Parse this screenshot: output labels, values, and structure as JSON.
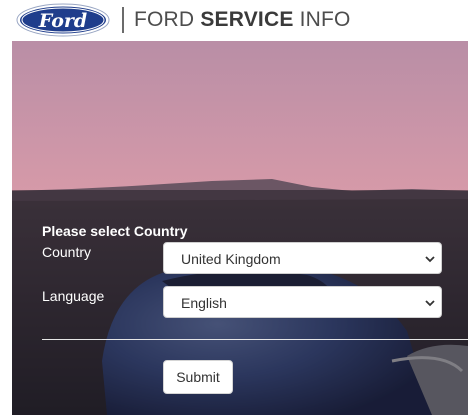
{
  "header": {
    "logo_text": "Ford",
    "title_regular_1": "FORD ",
    "title_bold": "SERVICE",
    "title_regular_2": " INFO"
  },
  "form": {
    "heading": "Please select Country",
    "country_label": "Country",
    "country_value": "United Kingdom",
    "language_label": "Language",
    "language_value": "English",
    "submit_label": "Submit"
  },
  "icons": [
    "ford-logo-icon",
    "chevron-down-icon"
  ],
  "colors": {
    "ford_blue": "#1f3d8c",
    "sky_top": "#c48ea3",
    "sky_bottom": "#e9a9a4",
    "panel_overlay": "#14121873"
  }
}
